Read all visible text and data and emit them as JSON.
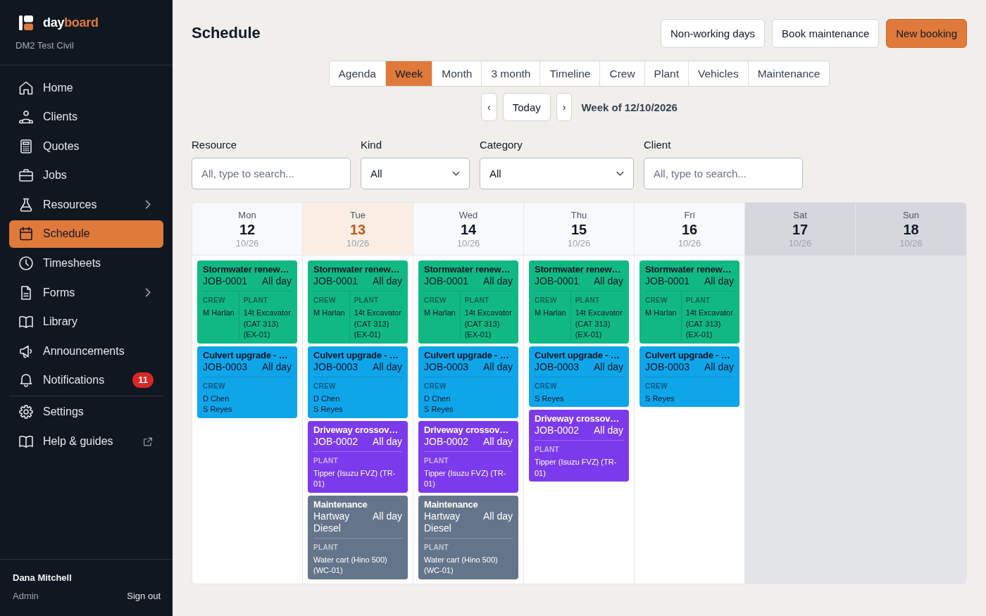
{
  "sidebar": {
    "logo": {
      "text_start": "day",
      "text_end": "board"
    },
    "organisation": "DM2 Test Civil",
    "nav_sections": [
      {
        "items": [
          {
            "label": "Home",
            "selected": false,
            "submenu": false,
            "external": false
          },
          {
            "label": "Clients",
            "selected": false,
            "submenu": false,
            "external": false
          },
          {
            "label": "Quotes",
            "selected": false,
            "submenu": false,
            "external": false
          },
          {
            "label": "Jobs",
            "selected": false,
            "submenu": false,
            "external": false
          },
          {
            "label": "Resources",
            "selected": false,
            "submenu": true,
            "external": false
          },
          {
            "label": "Schedule",
            "selected": true,
            "submenu": false,
            "external": false
          },
          {
            "label": "Timesheets",
            "selected": false,
            "submenu": false,
            "external": false
          },
          {
            "label": "Forms",
            "selected": false,
            "submenu": true,
            "external": false
          },
          {
            "label": "Library",
            "selected": false,
            "submenu": false,
            "external": false
          },
          {
            "label": "Announcements",
            "selected": false,
            "submenu": false,
            "external": false
          },
          {
            "label": "Notifications",
            "selected": false,
            "submenu": false,
            "external": false,
            "badge": "11"
          }
        ]
      },
      {
        "items": [
          {
            "label": "Settings",
            "selected": false,
            "submenu": false,
            "external": false
          },
          {
            "label": "Help & guides",
            "selected": false,
            "submenu": false,
            "external": true
          }
        ]
      }
    ],
    "user": {
      "name": "Dana Mitchell",
      "role": "Admin",
      "sign_out": "Sign out"
    }
  },
  "page": {
    "title": "Schedule",
    "actions": [
      {
        "label": "Non-working days",
        "kind": "secondary"
      },
      {
        "label": "Book maintenance",
        "kind": "secondary"
      },
      {
        "label": "New booking",
        "kind": "primary"
      }
    ]
  },
  "view_tabs": [
    {
      "label": "Agenda",
      "selected": false
    },
    {
      "label": "Week",
      "selected": true
    },
    {
      "label": "Month",
      "selected": false
    },
    {
      "label": "3 month",
      "selected": false
    },
    {
      "label": "Timeline",
      "selected": false
    },
    {
      "label": "Crew",
      "selected": false
    },
    {
      "label": "Plant",
      "selected": false
    },
    {
      "label": "Vehicles",
      "selected": false
    },
    {
      "label": "Maintenance",
      "selected": false
    }
  ],
  "week_nav": {
    "previous": "‹",
    "today": "Today",
    "next": "›",
    "label": "Week of 12/10/2026"
  },
  "filters": [
    {
      "label": "Resource",
      "kind": "search",
      "placeholder": "All, type to search..."
    },
    {
      "label": "Kind",
      "kind": "select",
      "value": "All"
    },
    {
      "label": "Category",
      "kind": "select",
      "value": "All"
    },
    {
      "label": "Client",
      "kind": "search",
      "placeholder": "All, type to search..."
    }
  ],
  "calendar": {
    "days": [
      {
        "weekday": "Mon",
        "day": "12",
        "date": "10/26",
        "today": false,
        "non_working": false,
        "events": [
          {
            "title": "Stormwater renew…",
            "subtitle": "JOB-0001",
            "time": "All day",
            "color": "#10b981",
            "sections": [
              {
                "heading": "CREW",
                "lines": [
                  "M Harlan"
                ]
              },
              {
                "heading": "PLANT",
                "lines": [
                  "14t Excavator (CAT 313) (EX-01)"
                ]
              }
            ]
          },
          {
            "title": "Culvert upgrade - …",
            "subtitle": "JOB-0003",
            "time": "All day",
            "color": "#0ea5e9",
            "sections": [
              {
                "heading": "CREW",
                "lines": [
                  "D Chen",
                  "S Reyes"
                ]
              }
            ]
          }
        ]
      },
      {
        "weekday": "Tue",
        "day": "13",
        "date": "10/26",
        "today": true,
        "non_working": false,
        "events": [
          {
            "title": "Stormwater renew…",
            "subtitle": "JOB-0001",
            "time": "All day",
            "color": "#10b981",
            "sections": [
              {
                "heading": "CREW",
                "lines": [
                  "M Harlan"
                ]
              },
              {
                "heading": "PLANT",
                "lines": [
                  "14t Excavator (CAT 313) (EX-01)"
                ]
              }
            ]
          },
          {
            "title": "Culvert upgrade - …",
            "subtitle": "JOB-0003",
            "time": "All day",
            "color": "#0ea5e9",
            "sections": [
              {
                "heading": "CREW",
                "lines": [
                  "D Chen",
                  "S Reyes"
                ]
              }
            ]
          },
          {
            "title": "Driveway crossov…",
            "subtitle": "JOB-0002",
            "time": "All day",
            "color": "#7c3aed",
            "sections": [
              {
                "heading": "PLANT",
                "lines": [
                  "Tipper (Isuzu FVZ) (TR-01)"
                ]
              }
            ]
          },
          {
            "title": "Maintenance",
            "subtitle": "Hartway Diesel",
            "time": "All day",
            "color": "#64748b",
            "sections": [
              {
                "heading": "PLANT",
                "lines": [
                  "Water cart (Hino 500) (WC-01)"
                ]
              }
            ]
          }
        ]
      },
      {
        "weekday": "Wed",
        "day": "14",
        "date": "10/26",
        "today": false,
        "non_working": false,
        "events": [
          {
            "title": "Stormwater renew…",
            "subtitle": "JOB-0001",
            "time": "All day",
            "color": "#10b981",
            "sections": [
              {
                "heading": "CREW",
                "lines": [
                  "M Harlan"
                ]
              },
              {
                "heading": "PLANT",
                "lines": [
                  "14t Excavator (CAT 313) (EX-01)"
                ]
              }
            ]
          },
          {
            "title": "Culvert upgrade - …",
            "subtitle": "JOB-0003",
            "time": "All day",
            "color": "#0ea5e9",
            "sections": [
              {
                "heading": "CREW",
                "lines": [
                  "D Chen",
                  "S Reyes"
                ]
              }
            ]
          },
          {
            "title": "Driveway crossov…",
            "subtitle": "JOB-0002",
            "time": "All day",
            "color": "#7c3aed",
            "sections": [
              {
                "heading": "PLANT",
                "lines": [
                  "Tipper (Isuzu FVZ) (TR-01)"
                ]
              }
            ]
          },
          {
            "title": "Maintenance",
            "subtitle": "Hartway Diesel",
            "time": "All day",
            "color": "#64748b",
            "sections": [
              {
                "heading": "PLANT",
                "lines": [
                  "Water cart (Hino 500) (WC-01)"
                ]
              }
            ]
          }
        ]
      },
      {
        "weekday": "Thu",
        "day": "15",
        "date": "10/26",
        "today": false,
        "non_working": false,
        "events": [
          {
            "title": "Stormwater renew…",
            "subtitle": "JOB-0001",
            "time": "All day",
            "color": "#10b981",
            "sections": [
              {
                "heading": "CREW",
                "lines": [
                  "M Harlan"
                ]
              },
              {
                "heading": "PLANT",
                "lines": [
                  "14t Excavator (CAT 313) (EX-01)"
                ]
              }
            ]
          },
          {
            "title": "Culvert upgrade - …",
            "subtitle": "JOB-0003",
            "time": "All day",
            "color": "#0ea5e9",
            "sections": [
              {
                "heading": "CREW",
                "lines": [
                  "S Reyes"
                ]
              }
            ]
          },
          {
            "title": "Driveway crossov…",
            "subtitle": "JOB-0002",
            "time": "All day",
            "color": "#7c3aed",
            "sections": [
              {
                "heading": "PLANT",
                "lines": [
                  "Tipper (Isuzu FVZ) (TR-01)"
                ]
              }
            ]
          }
        ]
      },
      {
        "weekday": "Fri",
        "day": "16",
        "date": "10/26",
        "today": false,
        "non_working": false,
        "events": [
          {
            "title": "Stormwater renew…",
            "subtitle": "JOB-0001",
            "time": "All day",
            "color": "#10b981",
            "sections": [
              {
                "heading": "CREW",
                "lines": [
                  "M Harlan"
                ]
              },
              {
                "heading": "PLANT",
                "lines": [
                  "14t Excavator (CAT 313) (EX-01)"
                ]
              }
            ]
          },
          {
            "title": "Culvert upgrade - …",
            "subtitle": "JOB-0003",
            "time": "All day",
            "color": "#0ea5e9",
            "sections": [
              {
                "heading": "CREW",
                "lines": [
                  "S Reyes"
                ]
              }
            ]
          }
        ]
      },
      {
        "weekday": "Sat",
        "day": "17",
        "date": "10/26",
        "today": false,
        "non_working": true
      },
      {
        "weekday": "Sun",
        "day": "18",
        "date": "10/26",
        "today": false,
        "non_working": true
      }
    ]
  }
}
